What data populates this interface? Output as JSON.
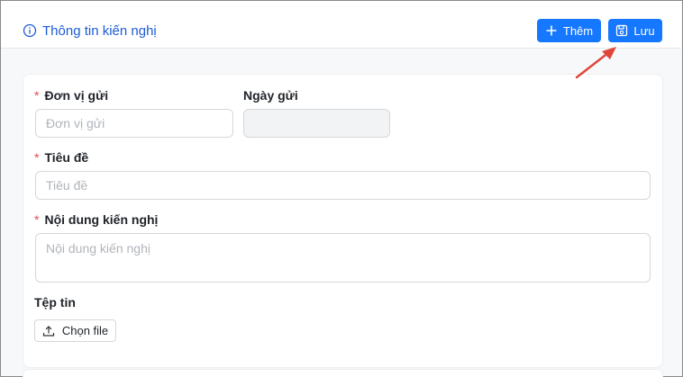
{
  "header": {
    "title": "Thông tin kiến nghị",
    "add_label": "Thêm",
    "save_label": "Lưu"
  },
  "form": {
    "sender_unit": {
      "label": "Đơn vị gửi",
      "required": true,
      "placeholder": "Đơn vị gửi",
      "value": ""
    },
    "send_date": {
      "label": "Ngày gửi",
      "required": false,
      "value": ""
    },
    "subject": {
      "label": "Tiêu đề",
      "required": true,
      "placeholder": "Tiêu đề",
      "value": ""
    },
    "content": {
      "label": "Nội dung kiến nghị",
      "required": true,
      "placeholder": "Nội dung kiến nghị",
      "value": ""
    },
    "attachment": {
      "label": "Tệp tin",
      "button_label": "Chọn file"
    }
  },
  "required_marker": "*",
  "colors": {
    "primary": "#1677ff",
    "title": "#1d5bd8",
    "required": "#e5484d",
    "annotation_arrow": "#e0453a"
  },
  "icons": {
    "title": "info-circle-icon",
    "add": "plus-icon",
    "save": "save-icon",
    "upload": "upload-icon"
  }
}
